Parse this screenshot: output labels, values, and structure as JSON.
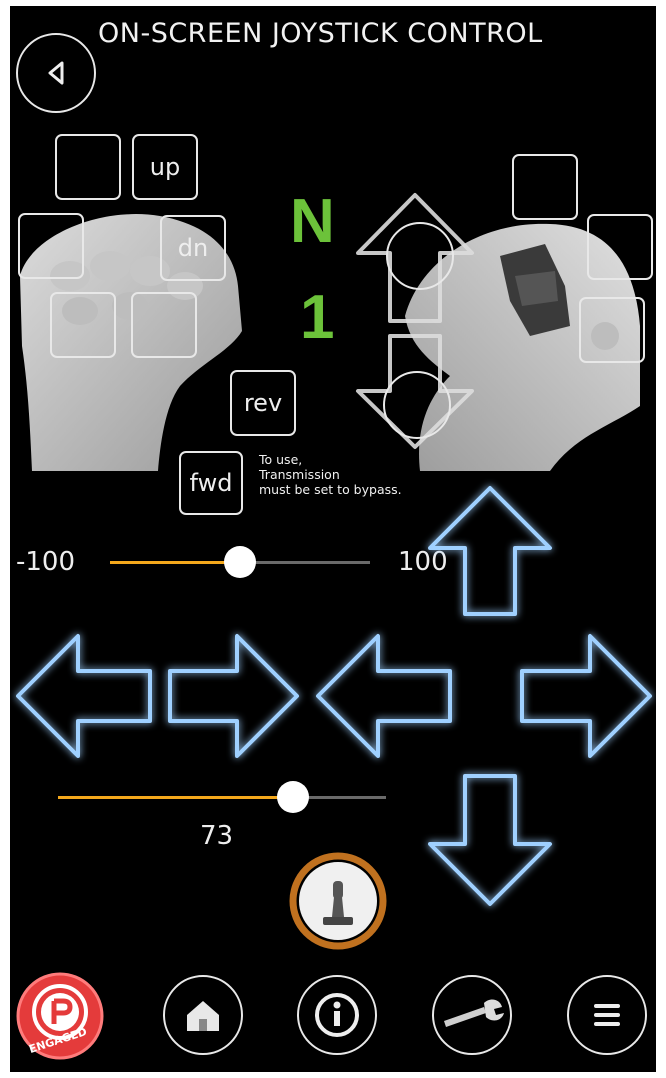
{
  "header": {
    "title": "ON-SCREEN JOYSTICK CONTROL"
  },
  "joystick_buttons": {
    "up": "up",
    "dn": "dn",
    "rev": "rev",
    "fwd": "fwd"
  },
  "transmission": {
    "gear": "N",
    "number": "1",
    "note_line1": "To use,",
    "note_line2": "Transmission",
    "note_line3": "must be set to bypass."
  },
  "slider_top": {
    "min_label": "-100",
    "max_label": "100",
    "value": 0
  },
  "slider_bottom": {
    "value_label": "73",
    "value": 73
  },
  "parking": {
    "label": "ENGAGED"
  },
  "colors": {
    "accent": "#f4a81c",
    "gear": "#6cc23a",
    "arrow_glow": "#2f7bff",
    "parking_red": "#e43b3b",
    "joystick_ring": "#c0711f"
  },
  "icons": [
    "back-icon",
    "joystick-icon",
    "parking-icon",
    "home-icon",
    "info-icon",
    "wrench-icon",
    "menu-icon"
  ]
}
